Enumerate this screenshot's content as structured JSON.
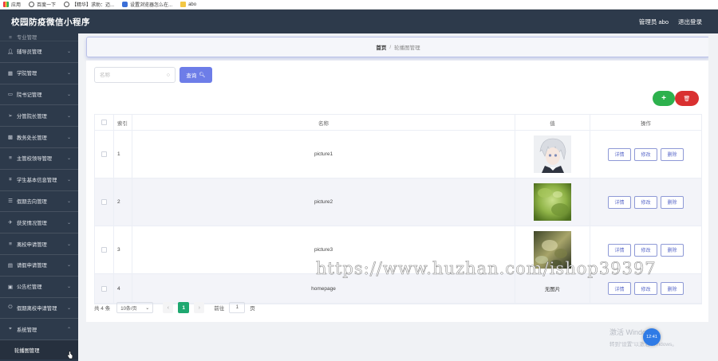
{
  "bookmarks": [
    {
      "label": "应用",
      "icon": "apps-grid-icon"
    },
    {
      "label": "百度一下",
      "icon": "globe-icon"
    },
    {
      "label": "【精华】求助：迈...",
      "icon": "globe-icon"
    },
    {
      "label": "设置浏览器怎么在...",
      "icon": "paw-icon"
    },
    {
      "label": "abo",
      "icon": "doc-icon"
    }
  ],
  "header": {
    "title": "校园防疫微信小程序",
    "admin_label": "管理员 abo",
    "logout_label": "退出登录"
  },
  "sidebar": {
    "cut_item": "专业管理",
    "items": [
      {
        "label": "辅导员管理",
        "icon": "users-icon"
      },
      {
        "label": "学院管理",
        "icon": "building-icon"
      },
      {
        "label": "院书记管理",
        "icon": "card-icon"
      },
      {
        "label": "分管院长管理",
        "icon": "send-icon"
      },
      {
        "label": "教务处长管理",
        "icon": "grid-icon"
      },
      {
        "label": "主管校领导管理",
        "icon": "list-icon"
      },
      {
        "label": "学生基本信息管理",
        "icon": "crop-icon"
      },
      {
        "label": "假期去向管理",
        "icon": "menu-icon"
      },
      {
        "label": "获奖情况管理",
        "icon": "plane-icon"
      },
      {
        "label": "离校申请管理",
        "icon": "list-icon"
      },
      {
        "label": "请假申请管理",
        "icon": "table-icon"
      },
      {
        "label": "公告栏管理",
        "icon": "notice-icon"
      },
      {
        "label": "假期离校申请管理",
        "icon": "power-icon"
      },
      {
        "label": "系统管理",
        "icon": "location-icon"
      }
    ],
    "sub_item": "轮播图管理"
  },
  "breadcrumb": {
    "home": "首页",
    "separator": "/",
    "current": "轮播图管理"
  },
  "search": {
    "placeholder": "名称",
    "button_label": "查询"
  },
  "actions": {
    "add_label": "+",
    "delete_label": "🗑"
  },
  "table": {
    "headers": {
      "index": "索引",
      "name": "名称",
      "value": "值",
      "ops": "操作"
    },
    "rows": [
      {
        "index": "1",
        "name": "picture1",
        "image": "anime-portrait"
      },
      {
        "index": "2",
        "name": "picture2",
        "image": "green-leaves"
      },
      {
        "index": "3",
        "name": "picture3",
        "image": "blurry-foliage"
      },
      {
        "index": "4",
        "name": "homepage",
        "value_text": "无图片"
      }
    ],
    "op_labels": {
      "detail": "详情",
      "edit": "修改",
      "delete": "删除"
    }
  },
  "pagination": {
    "total": "共 4 条",
    "page_size": "10条/页",
    "current_page": "1",
    "goto_label": "前往",
    "goto_value": "1",
    "page_suffix": "页"
  },
  "overlay": {
    "watermark": "https://www.huzhan.com/ishop39397",
    "windows_activate": "激活 Windows",
    "windows_activate_sub": "转到\"设置\"以激活 Windows。",
    "clock": "12:41"
  },
  "colors": {
    "sidebar_bg": "#2d3a4b",
    "search_btn": "#6d7de8",
    "add_btn": "#2db14d",
    "delete_btn": "#d93030",
    "page_active": "#1fa870"
  }
}
